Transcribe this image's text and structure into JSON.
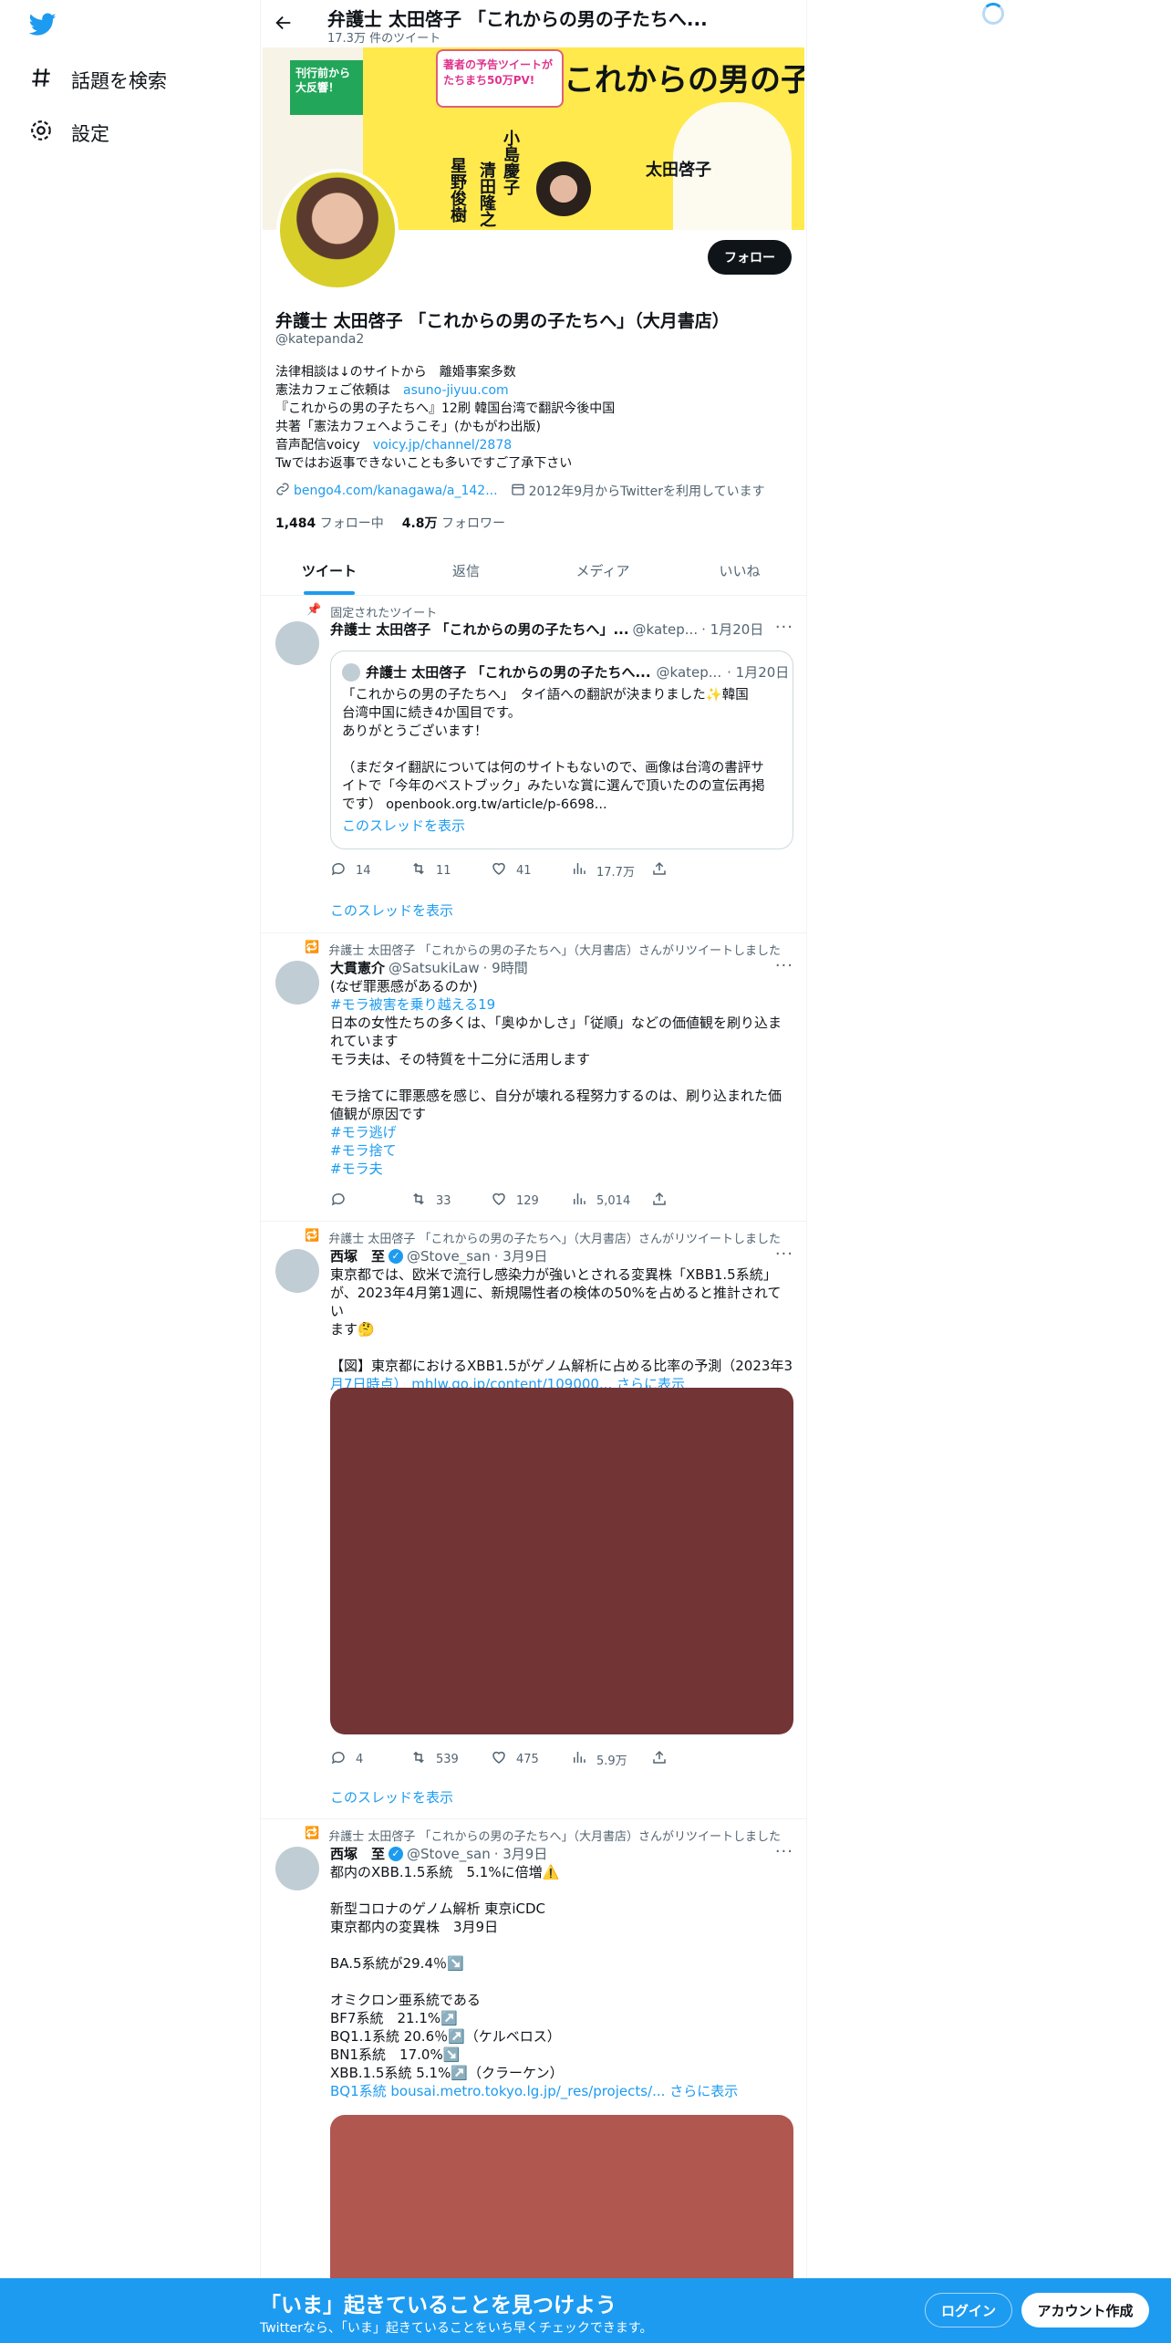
{
  "nav": {
    "explore_label": "話題を検索",
    "settings_label": "設定"
  },
  "header": {
    "name": "弁護士 太田啓子 「これからの男の子たちへ...",
    "tweet_count": "17.3万 件のツイート"
  },
  "profile": {
    "follow_label": "フォロー",
    "name": "弁護士 太田啓子 「これからの男の子たちへ」（大月書店）",
    "handle": "@katepanda2",
    "bio": [
      {
        "text": "法律相談は↓のサイトから　離婚事案多数",
        "link": ""
      },
      {
        "text": "憲法カフェご依頼は　",
        "link": "asuno-jiyuu.com"
      },
      {
        "text": "『これからの男の子たちへ』12刷 韓国台湾で翻訳今後中国",
        "link": ""
      },
      {
        "text": "共著「憲法カフェへようこそ」(かもがわ出版)",
        "link": ""
      },
      {
        "text": "音声配信voicy　",
        "link": "voicy.jp/channel/2878"
      },
      {
        "text": "Twではお返事できないことも多いですご了承下さい",
        "link": ""
      }
    ],
    "website": "bengo4.com/kanagawa/a_142...",
    "joined": "2012年9月からTwitterを利用しています",
    "following_count": "1,484",
    "following_label": "フォロー中",
    "followers_count": "4.8万",
    "followers_label": "フォロワー",
    "banner": {
      "tag1": "刊行前から大反響！",
      "tag2": "著者の予告ツイートがたちまち50万PV!",
      "title": "これからの男の子たちへ",
      "names": [
        "清田隆之",
        "小島慶子",
        "星野俊樹",
        "太田啓子"
      ]
    }
  },
  "tabs": [
    "ツイート",
    "返信",
    "メディア",
    "いいね"
  ],
  "tweets": [
    {
      "context": "固定されたツイート",
      "name": "弁護士 太田啓子 「これからの男の子たちへ」...",
      "handle": "@katep...",
      "time": "· 1月20日",
      "quote": {
        "name": "弁護士 太田啓子 「これからの男の子たちへ...",
        "handle": "@katep...",
        "time": "· 1月20日",
        "lines": [
          "「これからの男の子たちへ」　タイ語への翻訳が決まりました✨韓国",
          "台湾中国に続き4か国目です。",
          "ありがとうございます！",
          "",
          "（まだタイ翻訳については何のサイトもないので、画像は台湾の書評サ",
          "イトで「今年のベストブック」みたいな賞に選んで頂いたのの宣伝再掲",
          "です） openbook.org.tw/article/p-6698..."
        ],
        "thread": "このスレッドを表示"
      },
      "replies": "14",
      "retweets": "11",
      "likes": "41",
      "views": "17.7万",
      "thread": "このスレッドを表示"
    },
    {
      "context": "弁護士 太田啓子 「これからの男の子たちへ」（大月書店）さんがリツイートしました",
      "name": "大貫憲介",
      "handle": "@SatsukiLaw",
      "time": "· 9時間",
      "lines": [
        "(なぜ罪悪感があるのか)",
        "#モラ被害を乗り越える19",
        "日本の女性たちの多くは、「奥ゆかしさ」「従順」などの価値観を刷り込ま",
        "れています",
        "モラ夫は、その特質を十二分に活用します",
        "",
        "モラ捨てに罪悪感を感じ、自分が壊れる程努力するのは、刷り込まれた価",
        "値観が原因です",
        "#モラ逃げ",
        "#モラ捨て",
        "#モラ夫"
      ],
      "replies": "",
      "retweets": "33",
      "likes": "129",
      "views": "5,014"
    },
    {
      "context": "弁護士 太田啓子 「これからの男の子たちへ」（大月書店）さんがリツイートしました",
      "name": "西塚　至",
      "handle": "@Stove_san",
      "time": "· 3月9日",
      "lines": [
        "東京都では、欧米で流行し感染力が強いとされる変異株「XBB1.5系統」",
        "が、2023年4月第1週に、新規陽性者の検体の50%を占めると推計されてい",
        "ます🤔",
        "",
        "【図】東京都におけるXBB1.5がゲノム解析に占める比率の予測（2023年3",
        "月7日時点） mhlw.go.jp/content/109000... さらに表示"
      ],
      "media_color": "#733436",
      "replies": "4",
      "retweets": "539",
      "likes": "475",
      "views": "5.9万",
      "thread": "このスレッドを表示"
    },
    {
      "context": "弁護士 太田啓子 「これからの男の子たちへ」（大月書店）さんがリツイートしました",
      "name": "西塚　至",
      "handle": "@Stove_san",
      "time": "· 3月9日",
      "lines": [
        "都内のXBB.1.5系統　5.1%に倍増⚠️",
        "",
        "新型コロナのゲノム解析 東京iCDC",
        "東京都内の変異株　3月9日",
        "",
        "BA.5系統が29.4％↘️",
        "",
        "オミクロン亜系統である",
        "BF7系統　21.1%↗️",
        "BQ1.1系統 20.6％↗️（ケルベロス）",
        "BN1系統　17.0%↘️",
        "XBB.1.5系統 5.1%↗️（クラーケン）",
        "BQ1系統 bousai.metro.tokyo.lg.jp/_res/projects/... さらに表示"
      ],
      "media_color": "#b05750"
    }
  ],
  "footer": {
    "title": "「いま」起きていることを見つけよう",
    "subtitle": "Twitterなら、「いま」起きていることをいち早くチェックできます。",
    "login": "ログイン",
    "signup": "アカウント作成"
  }
}
